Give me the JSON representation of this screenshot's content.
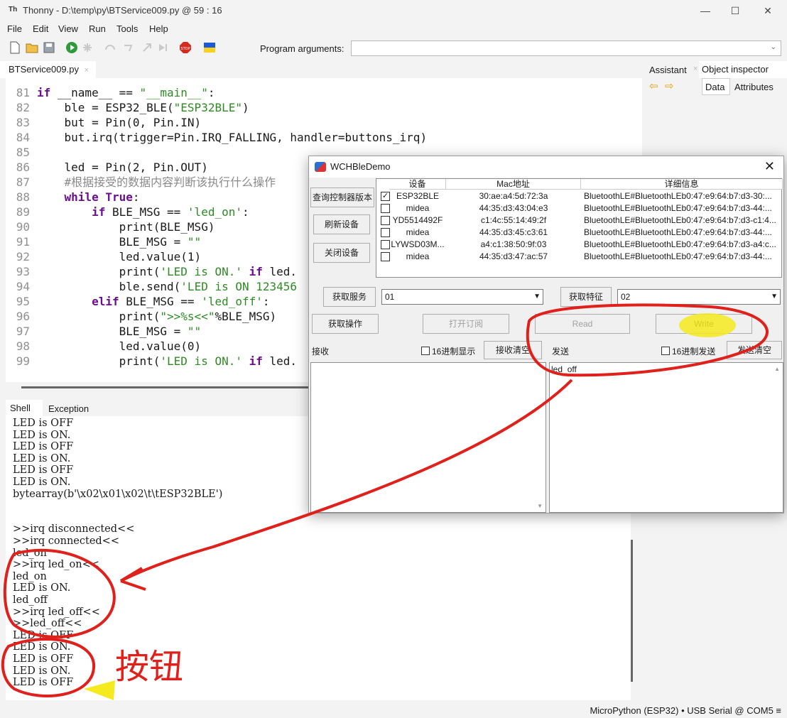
{
  "window": {
    "app_name": "Thonny",
    "title": "Thonny  -  D:\\temp\\py\\BTService009.py  @  59 : 16"
  },
  "menu": [
    "File",
    "Edit",
    "View",
    "Run",
    "Tools",
    "Help"
  ],
  "toolbar": {
    "program_arguments_label": "Program arguments:",
    "program_arguments_value": ""
  },
  "editor": {
    "tab_label": "BTService009.py",
    "lines": [
      {
        "n": "81"
      },
      {
        "n": "82"
      },
      {
        "n": "83"
      },
      {
        "n": "84"
      },
      {
        "n": "85"
      },
      {
        "n": "86"
      },
      {
        "n": "87"
      },
      {
        "n": "88"
      },
      {
        "n": "89"
      },
      {
        "n": "90"
      },
      {
        "n": "91"
      },
      {
        "n": "92"
      },
      {
        "n": "93"
      },
      {
        "n": "94"
      },
      {
        "n": "95"
      },
      {
        "n": "96"
      },
      {
        "n": "97"
      },
      {
        "n": "98"
      },
      {
        "n": "99"
      }
    ],
    "code": {
      "l81_kw": "if",
      "l81_rest": " __name__ == ",
      "l81_str": "\"__main__\"",
      "l81_end": ":",
      "l82_a": "    ble = ESP32_BLE(",
      "l82_str": "\"ESP32BLE\"",
      "l82_b": ")",
      "l83": "    but = Pin(0, Pin.IN)",
      "l84": "    but.irq(trigger=Pin.IRQ_FALLING, handler=buttons_irq)",
      "l86": "    led = Pin(2, Pin.OUT)",
      "l87": "    #根据接受的数据内容判断该执行什么操作",
      "l88_kw": "while",
      "l88_b": " ",
      "l88_kw2": "True",
      "l88_c": ":",
      "l89_kw": "if",
      "l89_a": " BLE_MSG == ",
      "l89_str": "'led_on'",
      "l89_b": ":",
      "l90": "            print(BLE_MSG)",
      "l91_a": "            BLE_MSG = ",
      "l91_str": "\"\"",
      "l92": "            led.value(1)",
      "l93_a": "            print(",
      "l93_str": "'LED is ON.'",
      "l93_b": " ",
      "l93_kw": "if",
      "l93_c": " led.",
      "l94_a": "            ble.send(",
      "l94_str": "'LED is ON 123456",
      "l95_kw": "elif",
      "l95_a": " BLE_MSG == ",
      "l95_str": "'led_off'",
      "l95_b": ":",
      "l96_a": "            print(",
      "l96_str": "\">>%s<<\"",
      "l96_b": "%BLE_MSG)",
      "l97_a": "            BLE_MSG = ",
      "l97_str": "\"\"",
      "l98": "            led.value(0)",
      "l99_a": "            print(",
      "l99_str": "'LED is ON.'",
      "l99_b": " ",
      "l99_kw": "if",
      "l99_c": " led."
    }
  },
  "right_pane": {
    "tab_assistant": "Assistant",
    "tab_object_inspector": "Object inspector",
    "tab_data": "Data",
    "tab_attributes": "Attributes"
  },
  "shell": {
    "tab_shell": "Shell",
    "tab_exception": "Exception",
    "lines": [
      "LED is OFF",
      "LED is ON.",
      "LED is OFF",
      "LED is ON.",
      "LED is OFF",
      "LED is ON.",
      "bytearray(b'\\x02\\x01\\x02\\t\\tESP32BLE')",
      "",
      "",
      ">>irq disconnected<<",
      ">>irq connected<<",
      "led_on",
      ">>irq led_on<<",
      "led_on",
      "LED is ON.",
      "led_off",
      ">>irq led_off<<",
      ">>led_off<<",
      "LED is OFF",
      "LED is ON.",
      "LED is OFF",
      "LED is ON.",
      "LED is OFF"
    ]
  },
  "status": "MicroPython (ESP32)  •  USB Serial @ COM5  ≡",
  "ble_window": {
    "title": "WCHBleDemo",
    "buttons": {
      "query_version": "查询控制器版本",
      "refresh": "刷新设备",
      "close_device": "关闭设备",
      "get_service": "获取服务",
      "get_characteristic": "获取特征",
      "get_operation": "获取操作",
      "subscribe": "打开订阅",
      "read": "Read",
      "write": "Write",
      "clear_receive": "接收清空",
      "clear_send": "发送清空"
    },
    "table": {
      "headers": [
        "设备",
        "Mac地址",
        "详细信息"
      ],
      "rows": [
        {
          "checked": true,
          "name": "ESP32BLE",
          "mac": "30:ae:a4:5d:72:3a",
          "detail": "BluetoothLE#BluetoothLEb0:47:e9:64:b7:d3-30:..."
        },
        {
          "checked": false,
          "name": "midea",
          "mac": "44:35:d3:43:04:e3",
          "detail": "BluetoothLE#BluetoothLEb0:47:e9:64:b7:d3-44:..."
        },
        {
          "checked": false,
          "name": "YD5514492F",
          "mac": "c1:4c:55:14:49:2f",
          "detail": "BluetoothLE#BluetoothLEb0:47:e9:64:b7:d3-c1:4..."
        },
        {
          "checked": false,
          "name": "midea",
          "mac": "44:35:d3:45:c3:61",
          "detail": "BluetoothLE#BluetoothLEb0:47:e9:64:b7:d3-44:..."
        },
        {
          "checked": false,
          "name": "LYWSD03M...",
          "mac": "a4:c1:38:50:9f:03",
          "detail": "BluetoothLE#BluetoothLEb0:47:e9:64:b7:d3-a4:c..."
        },
        {
          "checked": false,
          "name": "midea",
          "mac": "44:35:d3:47:ac:57",
          "detail": "BluetoothLE#BluetoothLEb0:47:e9:64:b7:d3-44:..."
        }
      ]
    },
    "service_value": "01",
    "characteristic_value": "02",
    "receive_label": "接收",
    "send_label": "发送",
    "hex_display": "16进制显示",
    "hex_send": "16进制发送",
    "send_text": "led_off"
  },
  "annotation": {
    "handwritten": "按钮",
    "ink_color": "#e0201a",
    "highlight_color": "#f5ea1f"
  }
}
